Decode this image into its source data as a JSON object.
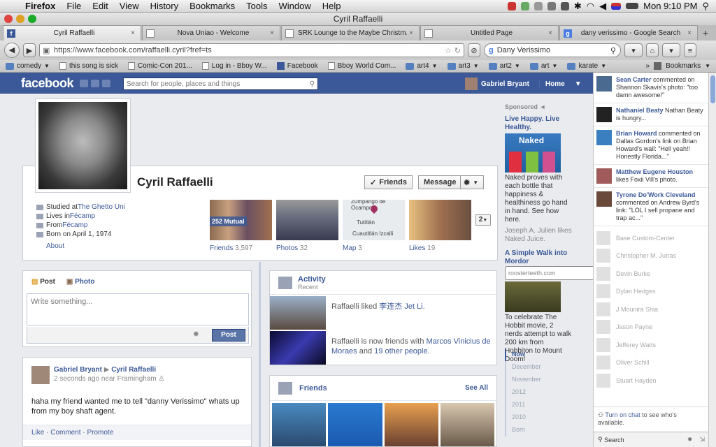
{
  "menubar": {
    "app": "Firefox",
    "items": [
      "File",
      "Edit",
      "View",
      "History",
      "Bookmarks",
      "Tools",
      "Window",
      "Help"
    ],
    "clock": "Mon 9:10 PM"
  },
  "window": {
    "title": "Cyril Raffaelli"
  },
  "tabs": [
    "Cyril Raffaelli",
    "Nova Uniao - Welcome",
    "SRK Lounge to the Maybe Christm...",
    "Untitled Page",
    "dany verissimo - Google Search"
  ],
  "nav": {
    "url": "https://www.facebook.com/raffaelli.cyril?fref=ts",
    "search": "Dany Verissimo"
  },
  "bookmarks": [
    {
      "label": "comedy",
      "type": "folder"
    },
    {
      "label": "this song is sick",
      "type": "page"
    },
    {
      "label": "Comic-Con 201...",
      "type": "page"
    },
    {
      "label": "Log in - Bboy W...",
      "type": "page"
    },
    {
      "label": "Facebook",
      "type": "fb"
    },
    {
      "label": "Bboy World Com...",
      "type": "page"
    },
    {
      "label": "art4",
      "type": "folder"
    },
    {
      "label": "art3",
      "type": "folder"
    },
    {
      "label": "art2",
      "type": "folder"
    },
    {
      "label": "art",
      "type": "folder"
    },
    {
      "label": "karate",
      "type": "folder"
    }
  ],
  "bookmarks_menu": "Bookmarks",
  "fb": {
    "logo": "facebook",
    "search_placeholder": "Search for people, places and things",
    "user": "Gabriel Bryant",
    "home": "Home"
  },
  "profile": {
    "name": "Cyril Raffaelli",
    "friends_btn": "Friends",
    "message_btn": "Message",
    "info": [
      {
        "pre": "Studied at ",
        "link": "The Ghetto Uni"
      },
      {
        "pre": "Lives in ",
        "link": "Fécamp"
      },
      {
        "pre": "From ",
        "link": "Fécamp"
      },
      {
        "pre": "Born on April 1, 1974",
        "link": ""
      }
    ],
    "about": "About",
    "more_count": "2",
    "thumbs": [
      {
        "label": "Friends",
        "count": "3,597",
        "badge": "252 Mutual"
      },
      {
        "label": "Photos",
        "count": "32"
      },
      {
        "label": "Map",
        "count": "3"
      },
      {
        "label": "Likes",
        "count": "19"
      }
    ],
    "map_labels": [
      "Zumpango de Ocampo",
      "Tutitlán",
      "Cuautitlán Izcalli"
    ]
  },
  "composer": {
    "post_tab": "Post",
    "photo_tab": "Photo",
    "placeholder": "Write something...",
    "post_btn": "Post"
  },
  "story": {
    "author": "Gabriel Bryant",
    "target": "Cyril Raffaelli",
    "meta": "2 seconds ago near Framingham",
    "body": "haha my friend wanted me to tell \"danny Verissimo\" whats up from my boy shaft agent.",
    "actions": "Like · Comment · Promote"
  },
  "activity": {
    "title": "Activity",
    "subtitle": "Recent",
    "items": [
      {
        "pre": "Raffaelli liked ",
        "link": "李连杰 Jet Li",
        "post": "."
      },
      {
        "pre": "Raffaelli is now friends with ",
        "link": "Marcos Vinicius de Moraes",
        "mid": " and ",
        "link2": "19 other people",
        "post": "."
      }
    ]
  },
  "friendsbox": {
    "title": "Friends",
    "see_all": "See All"
  },
  "sponsored": {
    "header": "Sponsored",
    "ad1": {
      "title": "Live Happy. Live Healthy.",
      "brand": "Naked",
      "body": "Naked proves with each bottle that happiness & healthiness go hand in hand. See how here.",
      "social": "Joseph A. Julien likes Naked Juice."
    },
    "ad2": {
      "title": "A Simple Walk into Mordor",
      "url": "roosterteeth.com",
      "body": "To celebrate The Hobbit movie, 2 nerds attempt to walk 200 km from Hobbiton to Mount Doom!"
    }
  },
  "years": [
    "Now",
    "December",
    "November",
    "2012",
    "2011",
    "2010",
    "Born"
  ],
  "ticker": [
    {
      "name": "Sean Carter",
      "text": " commented on Shannon Skavis's photo: \"too damn awesome!\""
    },
    {
      "name": "Nathaniel Beaty",
      "text": " Nathan Beaty is hungry..."
    },
    {
      "name": "Brian Howard",
      "text": " commented on Dallas Gordon's link on Brian Howard's wall: \"Hell yeah!! Honestly Florida...\""
    },
    {
      "name": "Matthew Eugene Houston",
      "text": " likes Foxii Vill's photo."
    },
    {
      "name": "Tyrone Do'Work Cleveland",
      "text": " commented on Andrew Byrd's link: \"LOL I sell propane and trap ac...\""
    }
  ],
  "chat": [
    "Base Custom-Center",
    "Christopher M. Jutras",
    "Devin Burke",
    "Dylan Hedges",
    "J Mounira Shia",
    "Jason Payne",
    "Jefferey Watts",
    "Oliver Schill",
    "Stuart Hayden"
  ],
  "chat_on": {
    "link": "Turn on chat",
    "text": " to see who's available."
  },
  "chat_search": "Search"
}
